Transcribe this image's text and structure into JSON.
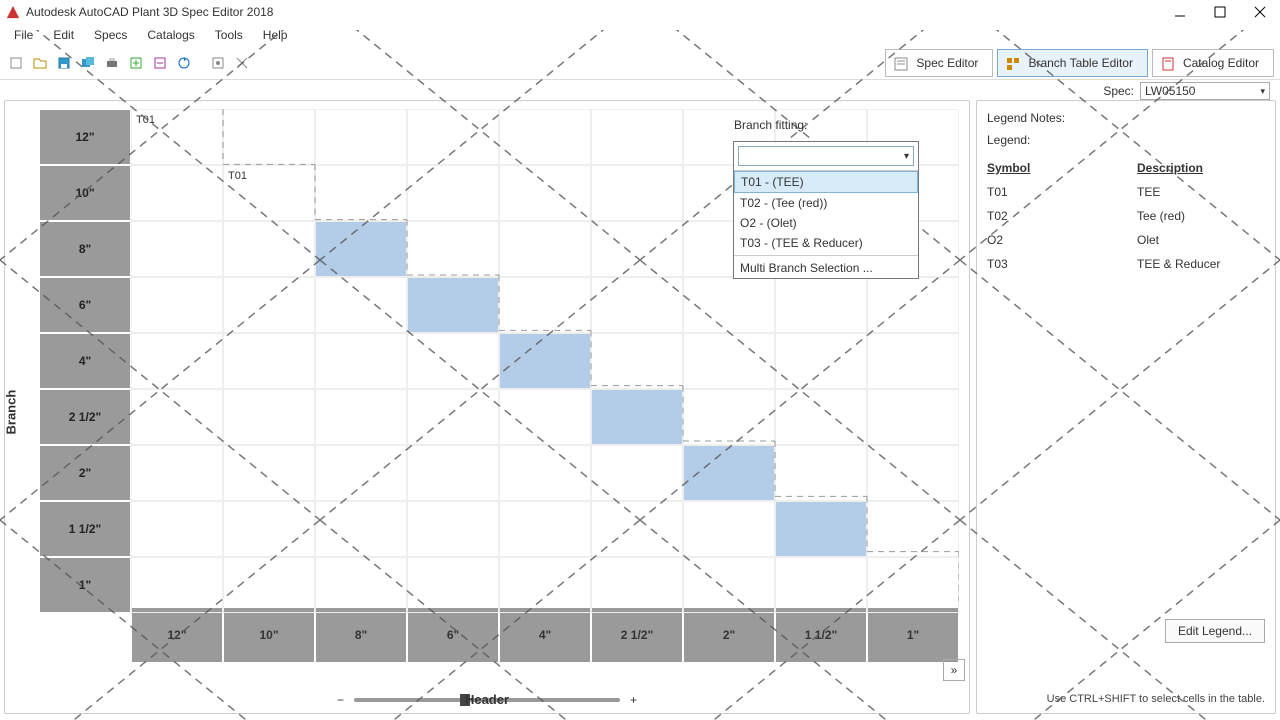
{
  "titlebar": {
    "title": "Autodesk AutoCAD Plant 3D Spec Editor 2018"
  },
  "menubar": [
    "File",
    "Edit",
    "Specs",
    "Catalogs",
    "Tools",
    "Help"
  ],
  "modes": {
    "spec": "Spec Editor",
    "branch": "Branch Table Editor",
    "catalog": "Catalog Editor"
  },
  "spec": {
    "label": "Spec:",
    "value": "LW05150"
  },
  "branch_fitting": {
    "label": "Branch fitting:",
    "items": [
      "T01 - (TEE)",
      "T02 - (Tee (red))",
      "O2 - (Olet)",
      "T03 - (TEE & Reducer)"
    ],
    "multi": "Multi Branch Selection ..."
  },
  "legend": {
    "notes": "Legend Notes:",
    "legend": "Legend:",
    "headers": {
      "symbol": "Symbol",
      "description": "Description"
    },
    "rows": [
      {
        "s": "T01",
        "d": "TEE"
      },
      {
        "s": "T02",
        "d": "Tee (red)"
      },
      {
        "s": "O2",
        "d": "Olet"
      },
      {
        "s": "T03",
        "d": "TEE & Reducer"
      }
    ],
    "edit": "Edit Legend..."
  },
  "grid": {
    "rows": [
      "12\"",
      "10\"",
      "8\"",
      "6\"",
      "4\"",
      "2 1/2\"",
      "2\"",
      "1 1/2\"",
      "1\""
    ],
    "cols": [
      "12\"",
      "10\"",
      "8\"",
      "6\"",
      "4\"",
      "2 1/2\"",
      "2\"",
      "1 1/2\"",
      "1\""
    ],
    "cell_labels": {
      "0_0": "T01",
      "1_1": "T01"
    },
    "highlighted": [
      "2_2",
      "3_3",
      "4_4",
      "5_5",
      "6_6",
      "7_7"
    ],
    "axis_branch": "Branch",
    "axis_header": "Header"
  },
  "hint": "Use CTRL+SHIFT to select cells in the table."
}
